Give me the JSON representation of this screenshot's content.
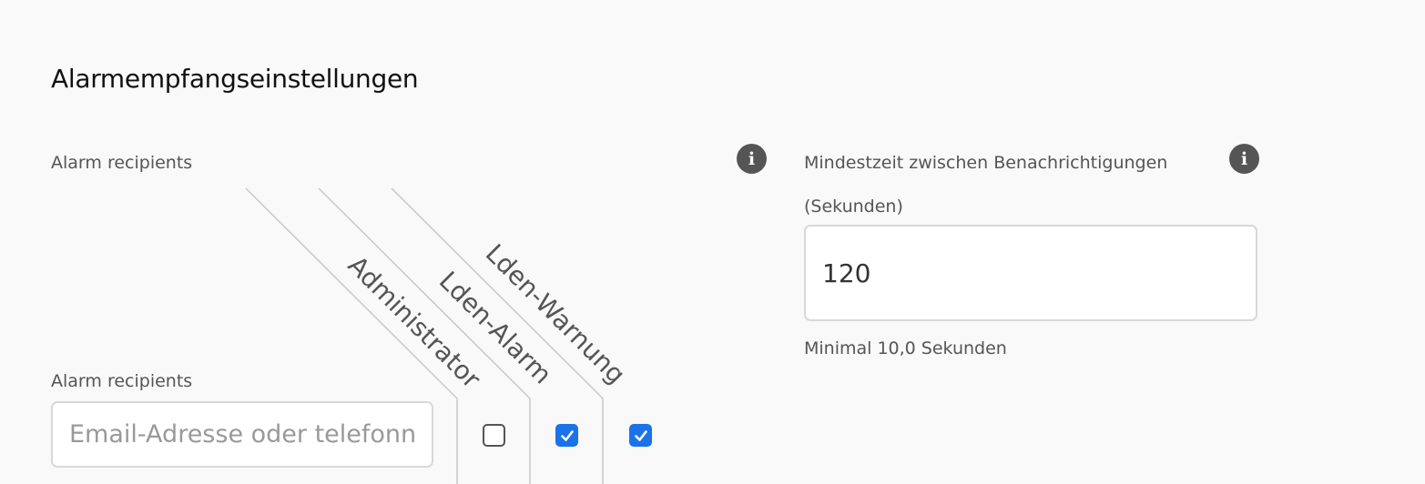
{
  "section": {
    "title": "Alarmempfangseinstellungen"
  },
  "recipients": {
    "header_label": "Alarm recipients",
    "field_label": "Alarm recipients",
    "input_placeholder": "Email-Adresse oder telefonn",
    "input_value": "",
    "columns": [
      {
        "label": "Administrator",
        "checked": false
      },
      {
        "label": "Lden-Alarm",
        "checked": true
      },
      {
        "label": "Lden-Warnung",
        "checked": true
      }
    ]
  },
  "min_interval": {
    "label_line1": "Mindestzeit zwischen Benachrichtigungen",
    "label_line2": "(Sekunden)",
    "value": "120",
    "hint": "Minimal 10,0 Sekunden"
  },
  "icons": {
    "info": "info-icon",
    "check": "checkmark-icon"
  },
  "colors": {
    "accent": "#1a73e8",
    "icon_bg": "#555555",
    "background": "#f9f9f9"
  }
}
